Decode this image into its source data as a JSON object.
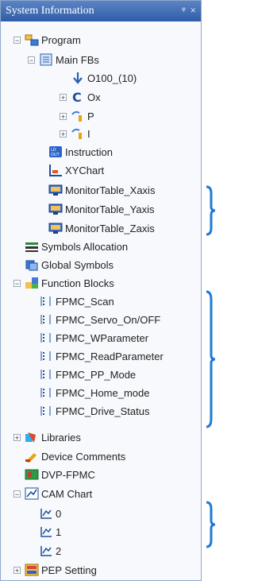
{
  "panel": {
    "title": "System Information",
    "pin": "ᵠ",
    "close": "×"
  },
  "tree": [
    {
      "id": "program",
      "label": "Program",
      "exp": "−",
      "icon": "program-icon"
    },
    {
      "id": "mainfbs",
      "label": "Main FBs",
      "exp": "−",
      "icon": "fb-icon"
    },
    {
      "id": "o100",
      "label": "O100_(10)",
      "exp": "",
      "icon": "arrow-down-icon"
    },
    {
      "id": "ox",
      "label": "Ox",
      "exp": "+",
      "icon": "c-icon"
    },
    {
      "id": "p",
      "label": "P",
      "exp": "+",
      "icon": "p-icon"
    },
    {
      "id": "i",
      "label": "I",
      "exp": "+",
      "icon": "i-icon"
    },
    {
      "id": "instruction",
      "label": "Instruction",
      "exp": "",
      "icon": "instruction-icon"
    },
    {
      "id": "xychart",
      "label": "XYChart",
      "exp": "",
      "icon": "chart-icon"
    },
    {
      "id": "mtx",
      "label": "MonitorTable_Xaxis",
      "exp": "",
      "icon": "monitor-icon"
    },
    {
      "id": "mty",
      "label": "MonitorTable_Yaxis",
      "exp": "",
      "icon": "monitor-icon"
    },
    {
      "id": "mtz",
      "label": "MonitorTable_Zaxis",
      "exp": "",
      "icon": "monitor-icon"
    },
    {
      "id": "symalloc",
      "label": "Symbols Allocation",
      "exp": "",
      "icon": "symbols-icon"
    },
    {
      "id": "globalsym",
      "label": "Global Symbols",
      "exp": "",
      "icon": "global-icon"
    },
    {
      "id": "funcblocks",
      "label": "Function Blocks",
      "exp": "−",
      "icon": "function-blocks-icon"
    },
    {
      "id": "scan",
      "label": "FPMC_Scan",
      "exp": "",
      "icon": "list-icon"
    },
    {
      "id": "servo",
      "label": "FPMC_Servo_On/OFF",
      "exp": "",
      "icon": "list-icon"
    },
    {
      "id": "wparam",
      "label": "FPMC_WParameter",
      "exp": "",
      "icon": "list-icon"
    },
    {
      "id": "rparam",
      "label": "FPMC_ReadParameter",
      "exp": "",
      "icon": "list-icon"
    },
    {
      "id": "ppmode",
      "label": "FPMC_PP_Mode",
      "exp": "",
      "icon": "list-icon"
    },
    {
      "id": "homemode",
      "label": "FPMC_Home_mode",
      "exp": "",
      "icon": "list-icon"
    },
    {
      "id": "drivestatus",
      "label": "FPMC_Drive_Status",
      "exp": "",
      "icon": "list-icon"
    },
    {
      "id": "libraries",
      "label": "Libraries",
      "exp": "+",
      "icon": "libraries-icon"
    },
    {
      "id": "devcomments",
      "label": "Device Comments",
      "exp": "",
      "icon": "comments-icon"
    },
    {
      "id": "dvpfpmc",
      "label": "DVP-FPMC",
      "exp": "",
      "icon": "device-icon"
    },
    {
      "id": "camchart",
      "label": "CAM Chart",
      "exp": "−",
      "icon": "cam-icon"
    },
    {
      "id": "cam0",
      "label": "0",
      "exp": "",
      "icon": "cam-item-icon"
    },
    {
      "id": "cam1",
      "label": "1",
      "exp": "",
      "icon": "cam-item-icon"
    },
    {
      "id": "cam2",
      "label": "2",
      "exp": "",
      "icon": "cam-item-icon"
    },
    {
      "id": "pep",
      "label": "PEP Setting",
      "exp": "+",
      "icon": "pep-icon"
    }
  ],
  "colors": {
    "title_bg": "#2f5da8",
    "brace": "#1e7ad6"
  }
}
